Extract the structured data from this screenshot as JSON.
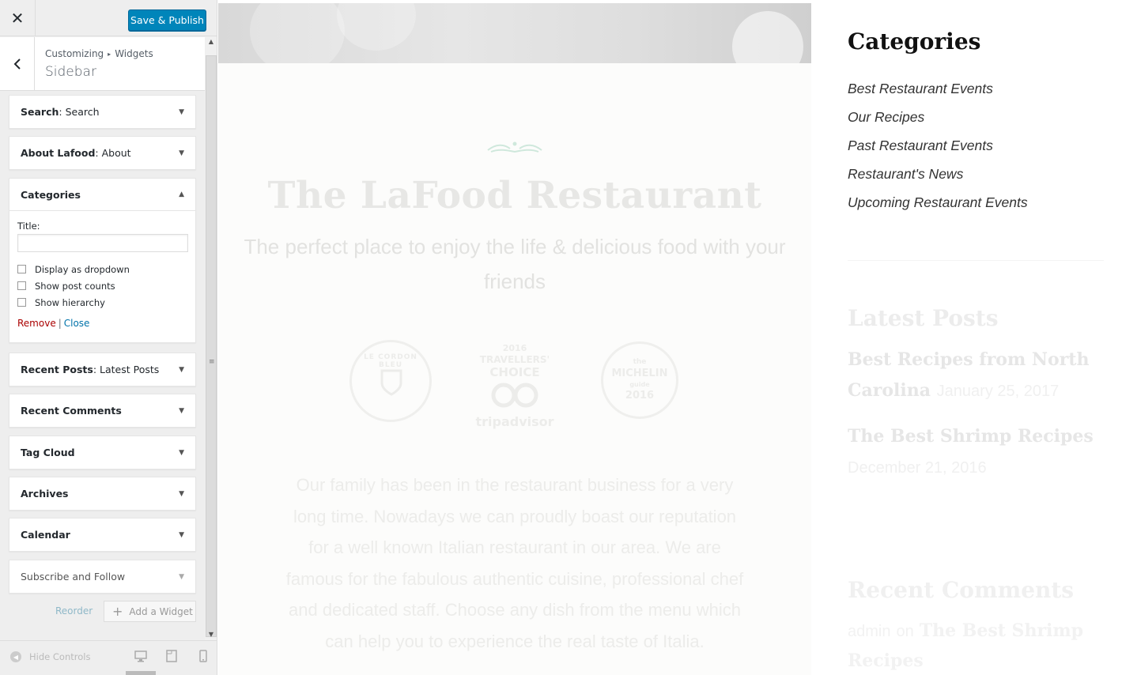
{
  "customizer": {
    "close_icon": "close-icon",
    "publish_label": "Save & Publish",
    "breadcrumb": {
      "parent": "Customizing",
      "current": "Widgets"
    },
    "section_title": "Sidebar",
    "widgets": [
      {
        "name": "Search",
        "title": "Search"
      },
      {
        "name": "About Lafood",
        "title": "About"
      },
      {
        "name": "Categories",
        "title": ""
      },
      {
        "name": "Recent Posts",
        "title": "Latest Posts"
      },
      {
        "name": "Recent Comments",
        "title": ""
      },
      {
        "name": "Tag Cloud",
        "title": ""
      },
      {
        "name": "Archives",
        "title": ""
      },
      {
        "name": "Calendar",
        "title": ""
      },
      {
        "name": "Subscribe and Follow",
        "title": ""
      }
    ],
    "categories_form": {
      "title_label": "Title:",
      "title_value": "",
      "options": [
        "Display as dropdown",
        "Show post counts",
        "Show hierarchy"
      ],
      "remove_label": "Remove",
      "separator": "|",
      "close_label": "Close"
    },
    "reorder_label": "Reorder",
    "add_widget_label": "Add a Widget",
    "hide_controls_label": "Hide Controls"
  },
  "preview": {
    "site_title": "The LaFood Restaurant",
    "tagline": "The perfect place to enjoy the life & delicious food with your friends",
    "awards": {
      "cordon": "LE CORDON BLEU",
      "tripadvisor_year": "2016",
      "tripadvisor_line1": "TRAVELLERS'",
      "tripadvisor_line2": "CHOICE",
      "tripadvisor_brand": "tripadvisor",
      "michelin_top": "the",
      "michelin_name": "MICHELIN",
      "michelin_sub": "guide",
      "michelin_year": "2016"
    },
    "about_text": "Our family has been in the restaurant business for a very long time. Nowadays we can proudly boast our reputation for a well known Italian restaurant in our area. We are famous for the fabulous authentic cuisine, professional chef and dedicated staff. Choose any dish from the menu which can help you to experience the real taste of Italia.",
    "sidebar": {
      "categories_heading": "Categories",
      "categories": [
        "Best Restaurant Events",
        "Our Recipes",
        "Past Restaurant Events",
        "Restaurant's News",
        "Upcoming Restaurant Events"
      ],
      "latest_posts_heading": "Latest Posts",
      "latest_posts": [
        {
          "title": "Best Recipes from North Carolina",
          "date": "January 25, 2017"
        },
        {
          "title": "The Best Shrimp Recipes",
          "date": "December 21, 2016"
        }
      ],
      "recent_comments_heading": "Recent Comments",
      "recent_comment": {
        "author": "admin",
        "on": "on",
        "post": "The Best Shrimp Recipes"
      }
    }
  }
}
